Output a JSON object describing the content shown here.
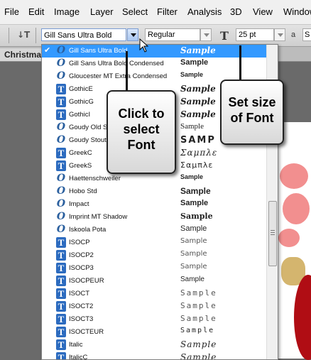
{
  "menu": [
    "File",
    "Edit",
    "Image",
    "Layer",
    "Select",
    "Filter",
    "Analysis",
    "3D",
    "View",
    "Window"
  ],
  "options_bar": {
    "font_family": "Gill Sans Ultra Bold",
    "font_style": "Regular",
    "font_size": "25 pt",
    "antialias_label": "a",
    "antialias_value": "S"
  },
  "document_tab": "Christmas",
  "font_list": [
    {
      "name": "Gill Sans Ultra Bold",
      "type": "O",
      "sample": "Sample",
      "selected": true
    },
    {
      "name": "Gill Sans Ultra Bold Condensed",
      "type": "O",
      "sample": "Sample"
    },
    {
      "name": "Gloucester MT Extra Condensed",
      "type": "O",
      "sample": "Sample"
    },
    {
      "name": "GothicE",
      "type": "T",
      "sample": "Sample"
    },
    {
      "name": "GothicG",
      "type": "T",
      "sample": "Sample"
    },
    {
      "name": "GothicI",
      "type": "T",
      "sample": "Sample"
    },
    {
      "name": "Goudy Old Style",
      "type": "O",
      "sample": "Sample"
    },
    {
      "name": "Goudy Stout",
      "type": "O",
      "sample": "SAMP"
    },
    {
      "name": "GreekC",
      "type": "T",
      "sample": "Σαμπλε"
    },
    {
      "name": "GreekS",
      "type": "T",
      "sample": "Σαμπλε"
    },
    {
      "name": "Haettenschweiler",
      "type": "O",
      "sample": "Sample"
    },
    {
      "name": "Hobo Std",
      "type": "O",
      "sample": "Sample"
    },
    {
      "name": "Impact",
      "type": "O",
      "sample": "Sample"
    },
    {
      "name": "Imprint MT Shadow",
      "type": "O",
      "sample": "Sample"
    },
    {
      "name": "Iskoola Pota",
      "type": "O",
      "sample": "Sample"
    },
    {
      "name": "ISOCP",
      "type": "T",
      "sample": "Sample"
    },
    {
      "name": "ISOCP2",
      "type": "T",
      "sample": "Sample"
    },
    {
      "name": "ISOCP3",
      "type": "T",
      "sample": "Sample"
    },
    {
      "name": "ISOCPEUR",
      "type": "T",
      "sample": "Sample"
    },
    {
      "name": "ISOCT",
      "type": "T",
      "sample": "Sample"
    },
    {
      "name": "ISOCT2",
      "type": "T",
      "sample": "Sample"
    },
    {
      "name": "ISOCT3",
      "type": "T",
      "sample": "Sample"
    },
    {
      "name": "ISOCTEUR",
      "type": "T",
      "sample": "Sample"
    },
    {
      "name": "Italic",
      "type": "T",
      "sample": "Sample"
    },
    {
      "name": "ItalicC",
      "type": "T",
      "sample": "Sample"
    }
  ],
  "callouts": {
    "select_font": "Click to select Font",
    "set_size": "Set size of Font"
  },
  "colors": {
    "selection": "#3399ff",
    "truetype_icon": "#2c6bbf",
    "opentype_icon": "#2a5f9e"
  }
}
